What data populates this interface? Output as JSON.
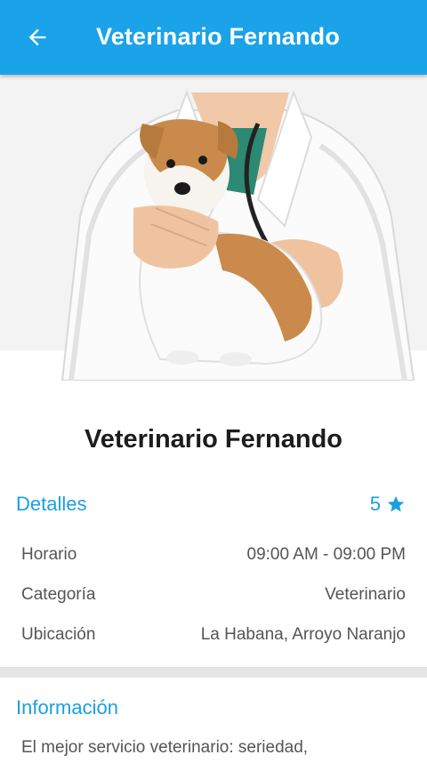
{
  "appbar": {
    "title": "Veterinario Fernando",
    "back_icon": "arrow-left-icon",
    "color": "#1aa3e8"
  },
  "hero": {
    "image": "veterinarian holding a small terrier dog with a stethoscope"
  },
  "profile": {
    "name": "Veterinario Fernando"
  },
  "details": {
    "section_label": "Detalles",
    "rating_value": "5",
    "rating_icon": "star-icon",
    "rows": [
      {
        "label": "Horario",
        "value": "09:00 AM - 09:00 PM"
      },
      {
        "label": "Categoría",
        "value": "Veterinario"
      },
      {
        "label": "Ubicación",
        "value": "La Habana, Arroyo Naranjo"
      }
    ]
  },
  "info": {
    "section_label": "Información",
    "text": "El mejor servicio veterinario: seriedad,"
  },
  "colors": {
    "accent": "#1a9fe0",
    "text": "#1c1c1c",
    "muted": "#555555"
  }
}
